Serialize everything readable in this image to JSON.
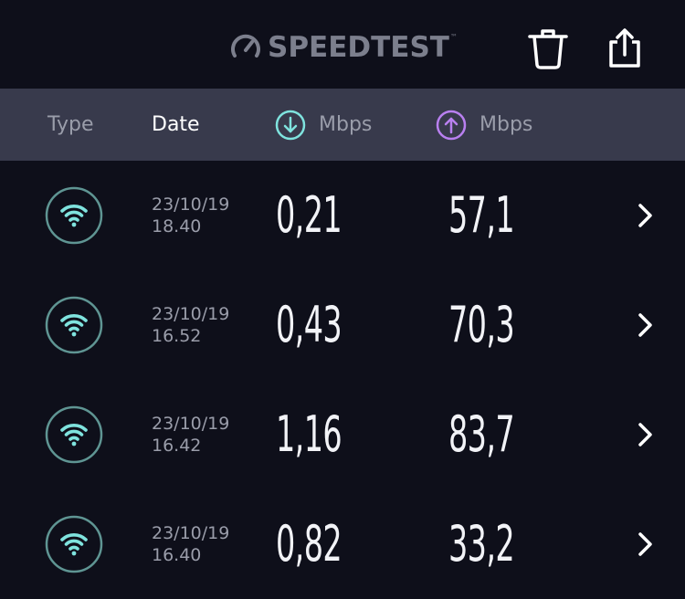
{
  "app": {
    "logo_text": "SPEEDTEST",
    "logo_icon": "speedometer-icon",
    "accent_text_color": "#7c7f8d"
  },
  "toolbar": {
    "trash_icon": "trash-icon",
    "share_icon": "share-icon"
  },
  "columns": {
    "type": "Type",
    "date": "Date",
    "download": "Mbps",
    "upload": "Mbps",
    "download_icon": "download-arrow-icon",
    "upload_icon": "upload-arrow-icon",
    "download_color": "#7fe3de",
    "upload_color": "#b980f0"
  },
  "results": [
    {
      "type_icon": "wifi-icon",
      "date": "23/10/19",
      "time": "18.40",
      "download": "0,21",
      "upload": "57,1"
    },
    {
      "type_icon": "wifi-icon",
      "date": "23/10/19",
      "time": "16.52",
      "download": "0,43",
      "upload": "70,3"
    },
    {
      "type_icon": "wifi-icon",
      "date": "23/10/19",
      "time": "16.42",
      "download": "1,16",
      "upload": "83,7"
    },
    {
      "type_icon": "wifi-icon",
      "date": "23/10/19",
      "time": "16.40",
      "download": "0,82",
      "upload": "33,2"
    }
  ]
}
